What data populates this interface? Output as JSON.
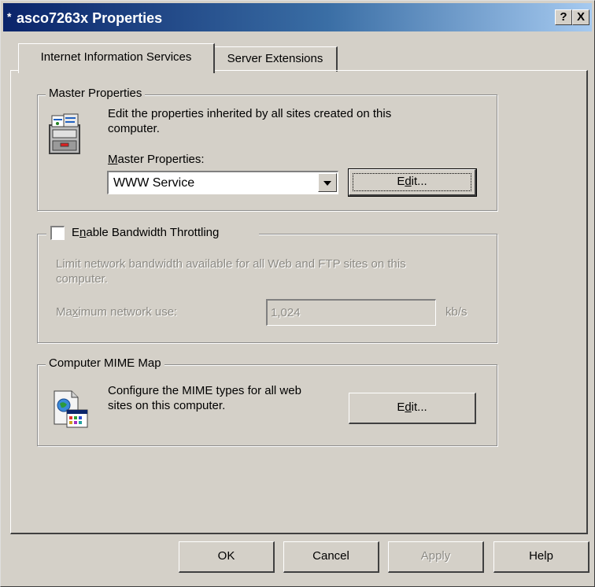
{
  "window": {
    "title": "asco7263x Properties",
    "title_icon": "*",
    "help_label": "?",
    "close_label": "X"
  },
  "tabs": [
    {
      "label": "Internet Information Services",
      "selected": true
    },
    {
      "label": "Server Extensions",
      "selected": false
    }
  ],
  "master_properties": {
    "group_label": "Master Properties",
    "description_line1": "Edit the properties inherited by all sites created on this",
    "description_line2": "computer.",
    "field_label_pre": "",
    "field_label_u": "M",
    "field_label_post": "aster Properties:",
    "selected_value": "WWW Service",
    "edit_pre": "E",
    "edit_u": "d",
    "edit_post": "it...",
    "icon": "master-properties-icon"
  },
  "bandwidth": {
    "checkbox_pre": "E",
    "checkbox_u": "n",
    "checkbox_post": "able Bandwidth Throttling",
    "checked": false,
    "description_line1": "Limit network bandwidth available for all Web and FTP sites on this",
    "description_line2": "computer.",
    "max_label_pre": "Ma",
    "max_label_u": "x",
    "max_label_post": "imum network use:",
    "max_value": "1,024",
    "unit": "kb/s"
  },
  "mime": {
    "group_label": "Computer MIME Map",
    "description_line1": "Configure the MIME types for all web",
    "description_line2": "sites on this computer.",
    "edit_pre": "E",
    "edit_u": "d",
    "edit_post": "it...",
    "icon": "mime-map-icon"
  },
  "buttons": {
    "ok": "OK",
    "cancel": "Cancel",
    "apply": "Apply",
    "help": "Help"
  }
}
